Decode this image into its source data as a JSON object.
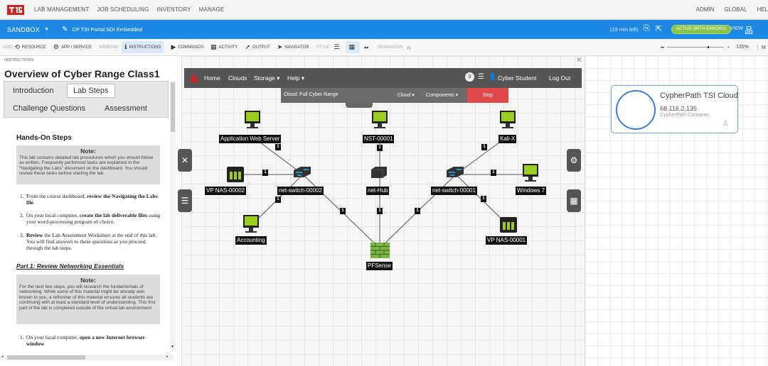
{
  "topbar": {
    "menu": [
      "LAB MANAGEMENT",
      "JOB SCHEDULING",
      "INVENTORY",
      "MANAGE"
    ],
    "right": [
      "ADMIN",
      "GLOBAL",
      "HEL"
    ]
  },
  "sandboxbar": {
    "sandbox_label": "SANDBOX",
    "sandbox_name": "CP TSI Portal SDI Embedded",
    "timer": "(19 min left)",
    "status": "ACTIVE (WITH ERRORS)",
    "view_label": "VIEW"
  },
  "toolbar": {
    "add_prefix": "ADD:",
    "resource": "RESOURCE",
    "app_service": "APP / SERVICE",
    "window_label": "WINDOW:",
    "instructions": "INSTRUCTIONS",
    "commands": "COMMANDS",
    "activity": "ACTIVITY",
    "output": "OUTPUT",
    "navigator": "NAVIGATOR",
    "style_label": "STYLE:",
    "behaviour_label": "BEHAVIOUR:",
    "zoom": "135%",
    "more": "M"
  },
  "instructions": {
    "panel_label": "INSTRUCTIONS",
    "title": "Overview of Cyber Range Class1",
    "tabs": [
      "Introduction",
      "Lab Steps",
      "Challenge Questions",
      "Assessment"
    ],
    "active_tab": "Lab Steps",
    "section1": "Hands-On Steps",
    "note_title": "Note:",
    "note1_body": "This lab contains detailed lab procedures which you should follow as written. Frequently performed tasks are explained in the \"Navigating the Labs\" document on the dashboard. You should review these tasks before starting the lab.",
    "steps1": [
      {
        "num": "1.",
        "a": "From the course dashboard, ",
        "b": "review the Navigating the Labs file",
        "c": "."
      },
      {
        "num": "2.",
        "a": "On your local computer, ",
        "b": "create the lab deliverable files",
        "c": " using your word-processing program of choice."
      },
      {
        "num": "3.",
        "a": "",
        "b": "Review",
        "c": " the Lab Assessment Worksheet at the end of this lab. You will find answers to these questions as you proceed through the lab steps."
      }
    ],
    "part1": "Part 1: Review Networking Essentials",
    "note2_body": "For the next few steps, you will research the fundamentals of networking. While some of this material might be already well known to you, a refresher of this material ensures all students are continuing with at least a standard level of understanding. This first part of the lab is completed outside of the virtual lab environment.",
    "step_last": {
      "num": "1.",
      "a": "On your local computer, ",
      "b": "open a new Internet browser window",
      "c": ""
    }
  },
  "labapp": {
    "nav": [
      "Home",
      "Clouds",
      "Storage ▾",
      "Help ▾"
    ],
    "badge": "3",
    "user": "Cyber Student",
    "logout": "Log Out",
    "cloud_title": "Cloud: Full Cyber Range",
    "cloud_menu": "Cloud ▾",
    "components_menu": "Components ▾",
    "stop": "Stop"
  },
  "diagram": {
    "nodes": {
      "app_web": "Application Web Server",
      "nst": "NST-00001",
      "kali": "Kali-X",
      "vpnas2": "VP NAS-00002",
      "sw2": "net-switch-00002",
      "hub": "net-Hub",
      "sw1": "net-switch-00001",
      "win7": "Windows 7",
      "accounting": "Accounting",
      "vpnas1": "VP NAS-00001",
      "pfsense": "PFSense"
    },
    "link_number": "1"
  },
  "cloud_card": {
    "name": "CypherPath TSI Cloud",
    "ip": "68.116.2.135",
    "type": "CypherPath Container"
  }
}
